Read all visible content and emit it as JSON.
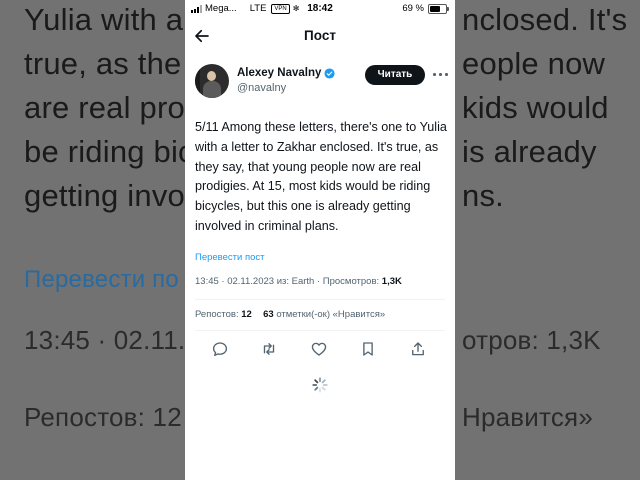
{
  "background": {
    "lines": [
      "Yulia with a",
      "true, as the",
      "are real prod",
      "be riding bic",
      "getting invol",
      "Перевести по",
      "13:45 · 02.11.2",
      "Репостов: 12"
    ],
    "right_lines": [
      "nclosed. It's",
      "eople now",
      "kids would",
      "is already",
      "ns.",
      "отров: 1,3K",
      "Нравится»"
    ]
  },
  "status_bar": {
    "carrier": "Mega...",
    "network": "LTE",
    "vpn": "VPN",
    "time": "18:42",
    "battery": "69 %"
  },
  "header": {
    "title": "Пост"
  },
  "author": {
    "name": "Alexey Navalny",
    "handle": "@navalny",
    "follow_label": "Читать"
  },
  "tweet": {
    "text": "5/11 Among these letters, there's one to Yulia with a letter to Zakhar enclosed. It's true, as they say, that young people now are real prodigies. At 15, most kids would be riding bicycles, but this one is already getting involved in criminal plans.",
    "translate_label": "Перевести пост",
    "meta_prefix": "13:45 · 02.11.2023 из: Earth · Просмотров: ",
    "views": "1,3K",
    "reposts_label": "Репостов:",
    "reposts_count": "12",
    "likes_count": "63",
    "likes_label": "отметки(-ок) «Нравится»"
  },
  "colors": {
    "accent": "#1d9bf0",
    "text": "#0f1419",
    "secondary": "#536471",
    "verified": "#1d9bf0"
  }
}
